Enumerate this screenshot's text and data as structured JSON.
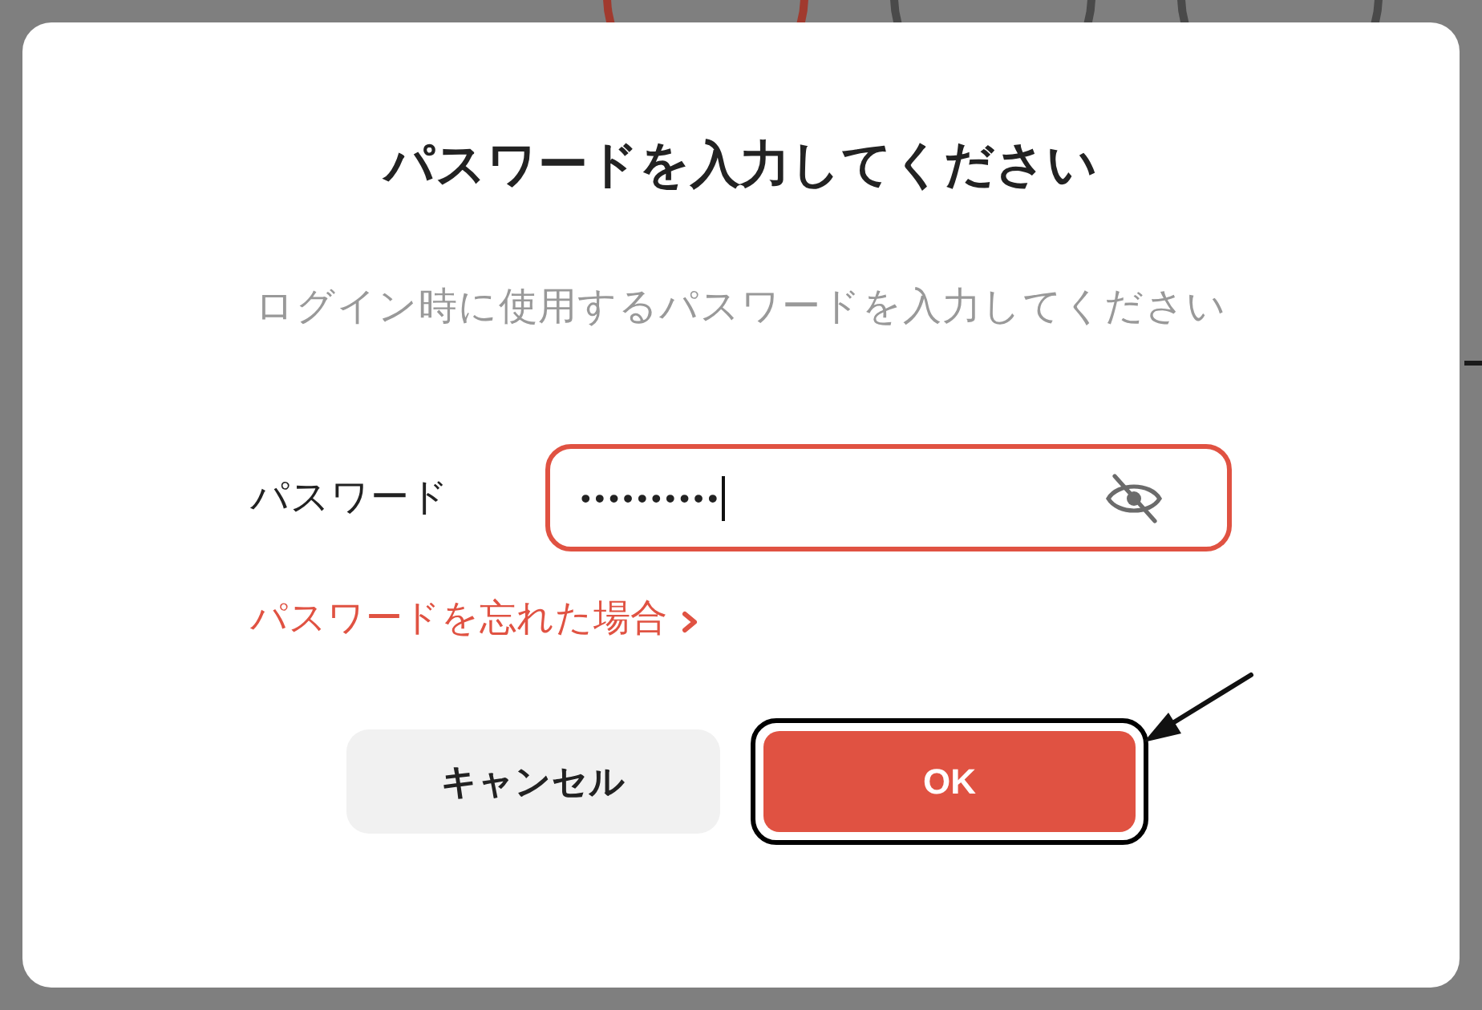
{
  "background_tabs": [
    {
      "selected": true
    },
    {
      "selected": false
    },
    {
      "selected": false
    }
  ],
  "dialog": {
    "title": "パスワードを入力してください",
    "subtitle": "ログイン時に使用するパスワードを入力してください",
    "password_field": {
      "label": "パスワード",
      "value": "••••••••••",
      "focused": true,
      "show_password": false
    },
    "forgot_password_link": "パスワードを忘れた場合",
    "buttons": [
      {
        "label": "キャンセル",
        "kind": "secondary",
        "highlighted": false
      },
      {
        "label": "OK",
        "kind": "primary",
        "highlighted": true
      }
    ]
  }
}
